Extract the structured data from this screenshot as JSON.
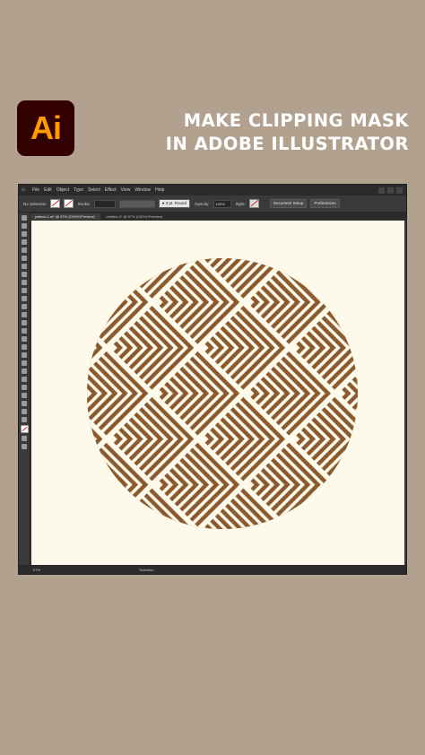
{
  "logo": {
    "text": "Ai"
  },
  "headline": {
    "line1": "MAKE CLIPPING MASK",
    "line2": "IN ADOBE ILLUSTRATOR"
  },
  "app": {
    "menu": [
      "File",
      "Edit",
      "Object",
      "Type",
      "Select",
      "Effect",
      "View",
      "Window",
      "Help"
    ],
    "control": {
      "selection": "No Selection",
      "stroke_label": "Stroke:",
      "style_label": "Style:",
      "opacity_label": "Opacity:",
      "opacity_value": "100%",
      "btn_document_setup": "Document Setup",
      "btn_preferences": "Preferences"
    },
    "tabs": {
      "active": "pattern-1.ai* @ 67% (CMYK/Preview)",
      "inactive": "Untitled-2* @ 67% (CMYK/Preview)"
    },
    "status": {
      "zoom": "67%",
      "tool": "Selection"
    }
  },
  "colors": {
    "pattern": "#8a5a2e",
    "artboard": "#fdfaec",
    "background": "#b3a190"
  }
}
